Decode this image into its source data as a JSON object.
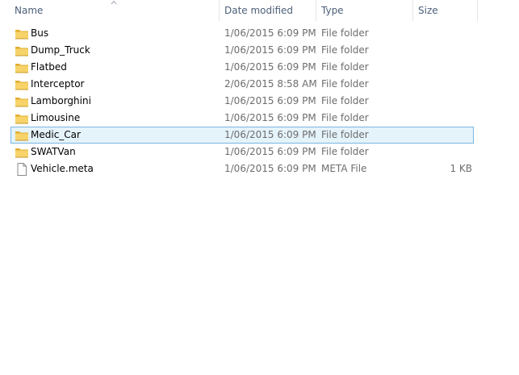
{
  "columns": {
    "name": "Name",
    "date": "Date modified",
    "type": "Type",
    "size": "Size"
  },
  "sort": {
    "column": "name",
    "direction": "ascending"
  },
  "selected_index": 7,
  "colors": {
    "folder": "#f7d36a",
    "folder_dark": "#e1ad2f",
    "selection_bg": "#e5f3fb",
    "selection_border": "#7cb6e0"
  },
  "files": [
    {
      "name": "Bus",
      "date": "1/06/2015 6:09 PM",
      "type": "File folder",
      "size": "",
      "icon": "folder-icon"
    },
    {
      "name": "Dump_Truck",
      "date": "1/06/2015 6:09 PM",
      "type": "File folder",
      "size": "",
      "icon": "folder-icon"
    },
    {
      "name": "Flatbed",
      "date": "1/06/2015 6:09 PM",
      "type": "File folder",
      "size": "",
      "icon": "folder-icon"
    },
    {
      "name": "Interceptor",
      "date": "2/06/2015 8:58 AM",
      "type": "File folder",
      "size": "",
      "icon": "folder-icon"
    },
    {
      "name": "Lamborghini",
      "date": "1/06/2015 6:09 PM",
      "type": "File folder",
      "size": "",
      "icon": "folder-icon"
    },
    {
      "name": "Limousine",
      "date": "1/06/2015 6:09 PM",
      "type": "File folder",
      "size": "",
      "icon": "folder-icon"
    },
    {
      "name": "Medic_Car",
      "date": "1/06/2015 6:09 PM",
      "type": "File folder",
      "size": "",
      "icon": "folder-icon"
    },
    {
      "name": "SWATVan",
      "date": "1/06/2015 6:09 PM",
      "type": "File folder",
      "size": "",
      "icon": "folder-icon"
    },
    {
      "name": "Vehicle.meta",
      "date": "1/06/2015 6:09 PM",
      "type": "META File",
      "size": "1 KB",
      "icon": "file-icon"
    }
  ]
}
